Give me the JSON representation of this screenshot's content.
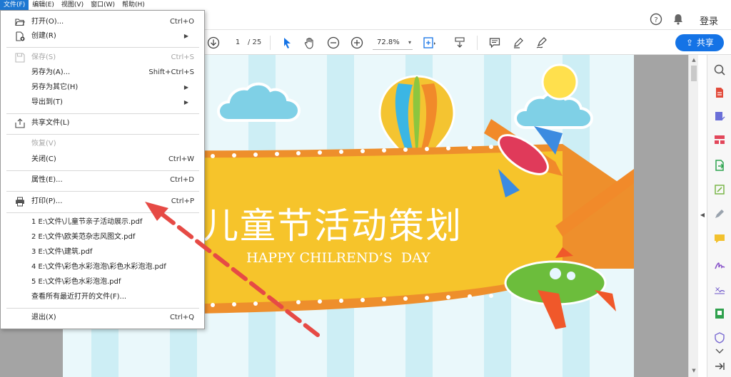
{
  "menubar": {
    "items": [
      "文件(F)",
      "编辑(E)",
      "视图(V)",
      "窗口(W)",
      "帮助(H)"
    ]
  },
  "header": {
    "login_label": "登录"
  },
  "toolbar": {
    "current_page": "1",
    "total_pages": "/ 25",
    "zoom": "72.8%",
    "share_label": "共享"
  },
  "file_menu": {
    "items": [
      {
        "label": "打开(O)...",
        "shortcut": "Ctrl+O",
        "enabled": true,
        "icon": "folder-open-icon"
      },
      {
        "label": "创建(R)",
        "shortcut": "",
        "submenu": true,
        "enabled": true,
        "icon": "create-pdf-icon"
      },
      {
        "label": "保存(S)",
        "shortcut": "Ctrl+S",
        "enabled": false,
        "icon": "save-icon"
      },
      {
        "label": "另存为(A)...",
        "shortcut": "Shift+Ctrl+S",
        "enabled": true
      },
      {
        "label": "另存为其它(H)",
        "shortcut": "",
        "submenu": true,
        "enabled": true
      },
      {
        "label": "导出到(T)",
        "shortcut": "",
        "submenu": true,
        "enabled": true
      },
      {
        "label": "共享文件(L)",
        "shortcut": "",
        "enabled": true,
        "icon": "share-file-icon"
      },
      {
        "label": "恢复(V)",
        "shortcut": "",
        "enabled": false
      },
      {
        "label": "关闭(C)",
        "shortcut": "Ctrl+W",
        "enabled": true
      },
      {
        "label": "属性(E)...",
        "shortcut": "Ctrl+D",
        "enabled": true
      },
      {
        "label": "打印(P)...",
        "shortcut": "Ctrl+P",
        "enabled": true,
        "icon": "printer-icon"
      },
      {
        "label": "1 E:\\文件\\儿童节亲子活动展示.pdf",
        "shortcut": "",
        "enabled": true
      },
      {
        "label": "2 E:\\文件\\欧美范杂志风图文.pdf",
        "shortcut": "",
        "enabled": true
      },
      {
        "label": "3 E:\\文件\\建筑.pdf",
        "shortcut": "",
        "enabled": true
      },
      {
        "label": "4 E:\\文件\\彩色水彩泡泡\\彩色水彩泡泡.pdf",
        "shortcut": "",
        "enabled": true
      },
      {
        "label": "5 E:\\文件\\彩色水彩泡泡.pdf",
        "shortcut": "",
        "enabled": true
      },
      {
        "label": "查看所有最近打开的文件(F)...",
        "shortcut": "",
        "enabled": true
      },
      {
        "label": "退出(X)",
        "shortcut": "Ctrl+Q",
        "enabled": true
      }
    ]
  },
  "document": {
    "title": "儿童节活动策划",
    "subtitle": "HAPPY CHILREND’S  DAY"
  },
  "colors": {
    "accent": "#1473e6",
    "menu_highlight": "#1e78d2",
    "banner_yellow": "#f6c42b",
    "banner_orange": "#ee8f2c",
    "annotation_arrow": "#e64a45"
  }
}
